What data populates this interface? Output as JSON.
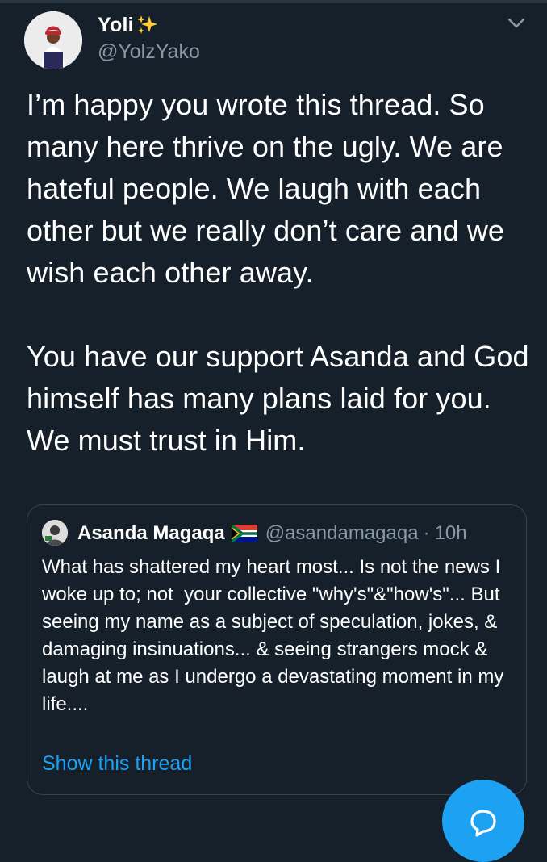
{
  "tweet": {
    "author_name": "Yoli",
    "author_emoji": "sparkles-icon",
    "handle": "@YolzYako",
    "text": "I’m happy you wrote this thread. So many here thrive on the ugly. We are hateful people. We laugh with each other but we really don’t care and we wish each other away.\n\nYou have our support Asanda and God himself has many plans laid for you. We must trust in Him."
  },
  "quoted_tweet": {
    "author_name": "Asanda Magaqa",
    "author_emoji": "south-africa-flag-icon",
    "handle": "@asandamagaqa",
    "separator": "·",
    "time": "10h",
    "text": "What has shattered my heart most... Is not the news I woke up to; not  your collective \"why's\"&\"how's\"... But seeing my name as a subject of speculation, jokes, & damaging insinuations... & seeing strangers mock & laugh at me as I undergo a devastating moment in my life....",
    "show_thread_label": "Show this thread"
  },
  "colors": {
    "background": "#15202b",
    "text_primary": "#ffffff",
    "text_secondary": "#8899a6",
    "border": "#38444d",
    "accent": "#1da1f2"
  },
  "icons": {
    "menu": "chevron-down-icon",
    "fab": "compose-icon"
  }
}
